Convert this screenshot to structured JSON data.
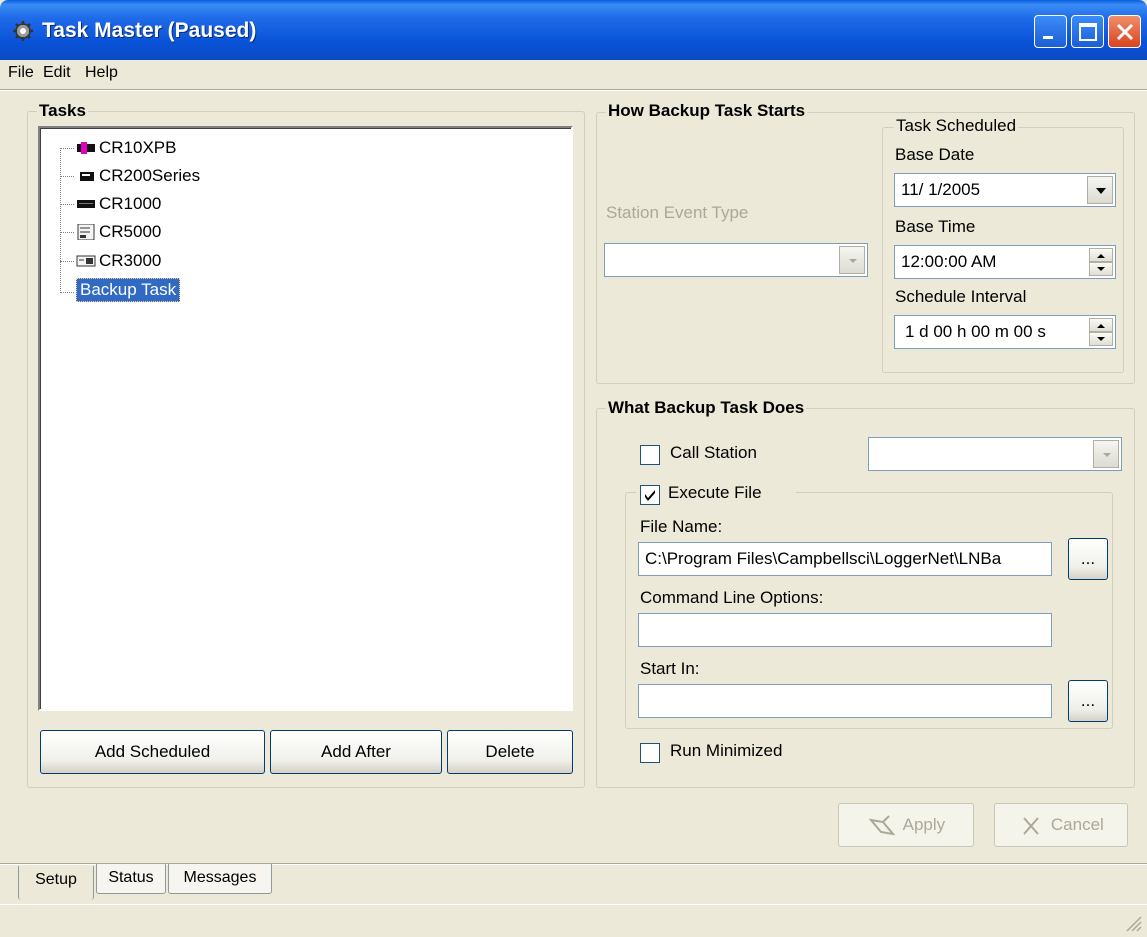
{
  "window": {
    "title": "Task Master (Paused)"
  },
  "menu": [
    "File",
    "Edit",
    "Help"
  ],
  "tasks": {
    "title": "Tasks",
    "items": [
      {
        "label": "CR10XPB",
        "icon": "datalogger-cr10xpb-icon"
      },
      {
        "label": "CR200Series",
        "icon": "datalogger-cr200-icon"
      },
      {
        "label": "CR1000",
        "icon": "datalogger-cr1000-icon"
      },
      {
        "label": "CR5000",
        "icon": "datalogger-cr5000-icon"
      },
      {
        "label": "CR3000",
        "icon": "datalogger-cr3000-icon"
      },
      {
        "label": "Backup Task",
        "selected": true
      }
    ],
    "buttons": {
      "add_scheduled": "Add Scheduled",
      "add_after": "Add After",
      "delete": "Delete"
    }
  },
  "how_starts": {
    "title": "How Backup Task Starts",
    "station_event_label": "Station Event Type",
    "station_event_value": "",
    "scheduled": {
      "title": "Task Scheduled",
      "base_date_label": "Base Date",
      "base_date": "11/ 1/2005",
      "base_time_label": "Base Time",
      "base_time": "12:00:00 AM",
      "interval_label": "Schedule Interval",
      "interval": "1 d 00 h 00 m 00 s"
    }
  },
  "what_does": {
    "title": "What Backup Task Does",
    "call_station_label": "Call Station",
    "call_station_checked": false,
    "call_station_value": "",
    "execute_file_label": "Execute File",
    "execute_file_checked": true,
    "file_name_label": "File Name:",
    "file_name": "C:\\Program Files\\Campbellsci\\LoggerNet\\LNBa",
    "browse_label": "...",
    "cmd_options_label": "Command Line Options:",
    "cmd_options": "",
    "start_in_label": "Start In:",
    "start_in": "",
    "run_minimized_label": "Run Minimized",
    "run_minimized_checked": false
  },
  "actions": {
    "apply": "Apply",
    "cancel": "Cancel"
  },
  "tabs": [
    "Setup",
    "Status",
    "Messages"
  ],
  "active_tab": "Setup"
}
